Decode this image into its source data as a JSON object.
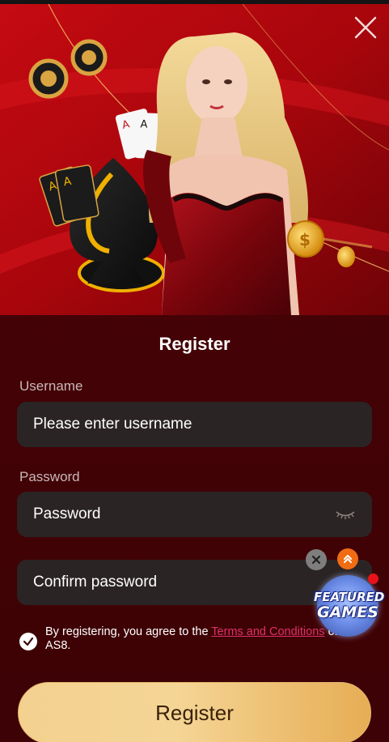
{
  "form": {
    "title": "Register",
    "username_label": "Username",
    "username_placeholder": "Please enter username",
    "password_label": "Password",
    "password_placeholder": "Password",
    "confirm_placeholder": "Confirm password",
    "agree_prefix": "By registering, you agree to the",
    "terms_link": "Terms and Conditions",
    "agree_suffix": "of AS8.",
    "agree_checked": true,
    "submit_label": "Register"
  },
  "floating": {
    "featured_line1": "FEATURED",
    "featured_line2": "GAMES"
  },
  "colors": {
    "background": "#3c0205",
    "field": "#2b2424",
    "link": "#e0306a",
    "button_gold": "#f3d18f",
    "banner_red": "#b5080f"
  },
  "icons": [
    "close-icon",
    "eye-closed-icon",
    "check-icon",
    "chevron-up-icon"
  ]
}
